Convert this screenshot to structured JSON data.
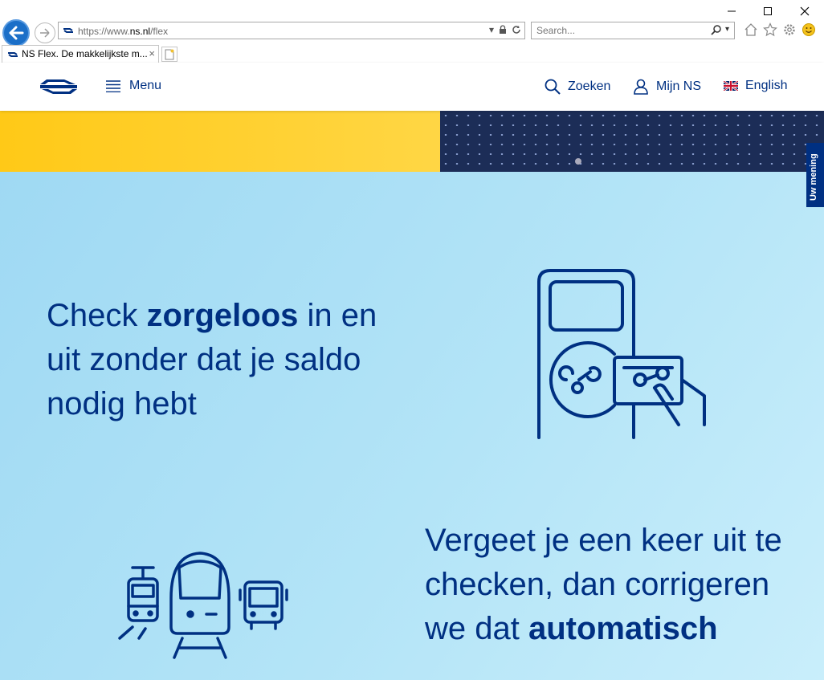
{
  "browser": {
    "url_scheme": "https://",
    "url_sub": "www.",
    "url_domain": "ns.nl",
    "url_path": "/flex",
    "search_placeholder": "Search...",
    "tab_title": "NS Flex. De makkelijkste m...",
    "tab_close": "×"
  },
  "header": {
    "menu_label": "Menu",
    "search_label": "Zoeken",
    "account_label": "Mijn NS",
    "language_label": "English"
  },
  "feedback_label": "Uw mening",
  "section1": {
    "pre": "Check ",
    "bold": "zorgeloos",
    "post": " in en uit zonder dat je saldo nodig hebt"
  },
  "section2": {
    "pre": "Vergeet je een keer uit te checken, dan corrigeren we dat ",
    "bold": "automatisch"
  },
  "colors": {
    "brand_blue": "#003082",
    "brand_yellow": "#ffc917",
    "light_blue": "#a9dff6"
  },
  "icons": [
    "back-arrow-icon",
    "forward-arrow-icon",
    "ns-logo",
    "lock-icon",
    "refresh-icon",
    "search-icon",
    "home-icon",
    "star-icon",
    "gear-icon",
    "smiley-icon",
    "hamburger-icon",
    "user-icon",
    "uk-flag-icon",
    "card-reader-icon",
    "transport-icon"
  ]
}
